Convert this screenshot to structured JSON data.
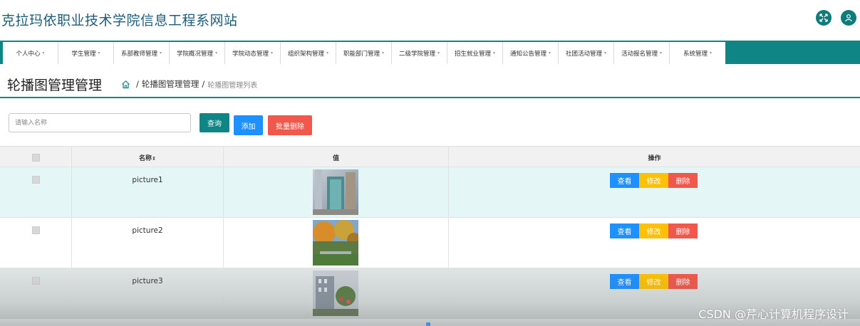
{
  "site": {
    "title": "克拉玛依职业技术学院信息工程系网站"
  },
  "header_icons": [
    {
      "name": "fullscreen-icon"
    },
    {
      "name": "user-icon"
    }
  ],
  "nav": {
    "items": [
      {
        "label": "个人中心"
      },
      {
        "label": "学生管理"
      },
      {
        "label": "系部教师管理"
      },
      {
        "label": "学院概况管理"
      },
      {
        "label": "学院动态管理"
      },
      {
        "label": "组织架构管理"
      },
      {
        "label": "职能部门管理"
      },
      {
        "label": "二级学院管理"
      },
      {
        "label": "招生就业管理"
      },
      {
        "label": "通知公告管理"
      },
      {
        "label": "社团活动管理"
      },
      {
        "label": "活动报名管理"
      },
      {
        "label": "系统管理"
      }
    ]
  },
  "page": {
    "title": "轮播图管理管理",
    "breadcrumb": {
      "sep1": "/",
      "parent": "轮播图管理管理",
      "sep2": "/",
      "current": "轮播图管理列表"
    }
  },
  "toolbar": {
    "search_placeholder": "请输入名称",
    "query_label": "查询",
    "add_label": "添加",
    "bulk_delete_label": "批量删除"
  },
  "table": {
    "headers": {
      "name": "名称",
      "sort_icon": "⇕",
      "value": "值",
      "actions": "操作"
    },
    "rows": [
      {
        "name": "picture1",
        "image": "building-entrance",
        "view": "查看",
        "edit": "修改",
        "delete": "删除"
      },
      {
        "name": "picture2",
        "image": "campus-trees",
        "view": "查看",
        "edit": "修改",
        "delete": "删除"
      },
      {
        "name": "picture3",
        "image": "campus-building-flowers",
        "view": "查看",
        "edit": "修改",
        "delete": "删除"
      }
    ]
  },
  "watermark": "CSDN @芹心计算机程序设计",
  "colors": {
    "primary": "#0f8585",
    "title": "#1d5c7a",
    "view": "#1e90ff",
    "edit": "#ffc107",
    "delete": "#f0584b"
  }
}
